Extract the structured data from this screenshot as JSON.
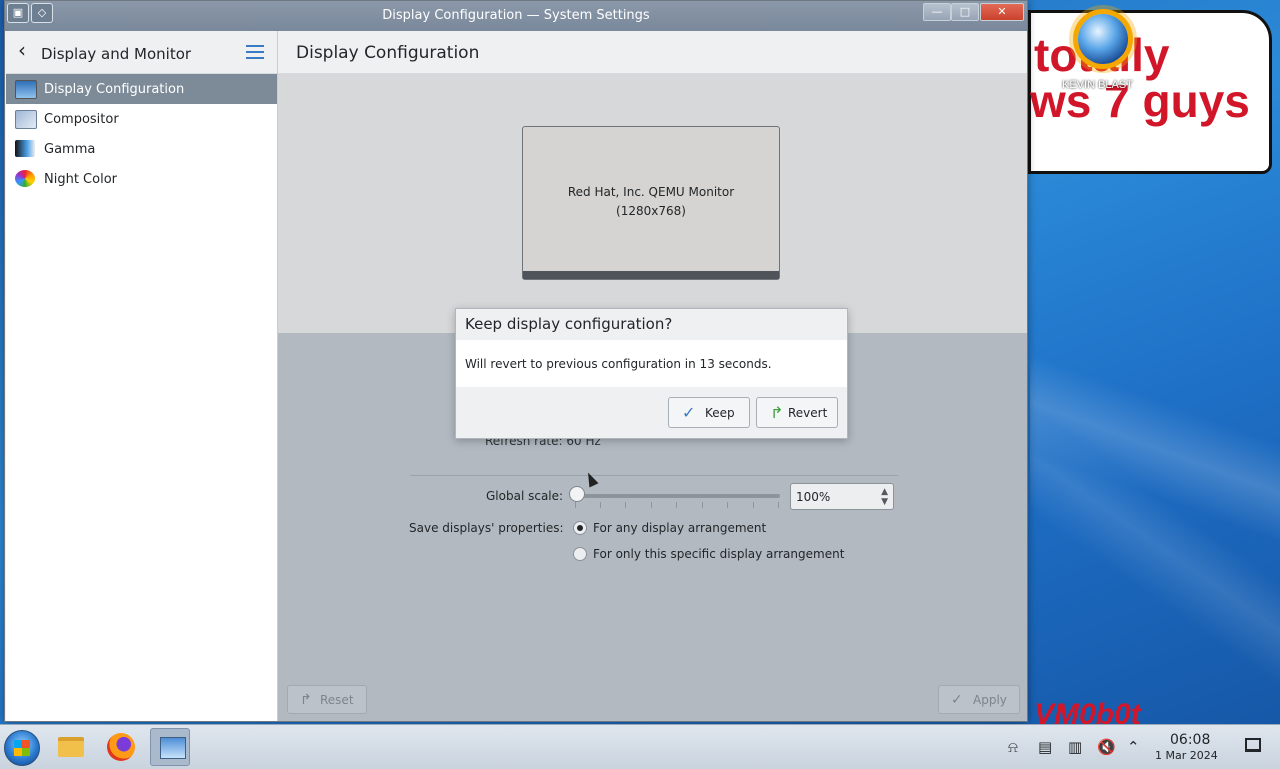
{
  "window": {
    "title": "Display Configuration — System Settings",
    "minimize_glyph": "—",
    "maximize_glyph": "□",
    "close_glyph": "✕"
  },
  "sidebar": {
    "header_title": "Display and Monitor",
    "items": [
      {
        "label": "Display Configuration",
        "icon": "display-icon",
        "selected": true
      },
      {
        "label": "Compositor",
        "icon": "compositor-icon",
        "selected": false
      },
      {
        "label": "Gamma",
        "icon": "gamma-icon",
        "selected": false
      },
      {
        "label": "Night Color",
        "icon": "night-color-icon",
        "selected": false
      }
    ]
  },
  "main": {
    "title": "Display Configuration",
    "monitor": {
      "name": "Red Hat, Inc. QEMU Monitor",
      "resolution": "(1280x768)"
    },
    "refresh_rate_label": "Refresh rate: 60 Hz",
    "global_scale": {
      "label": "Global scale:",
      "value": "100%",
      "slider_fraction": 0.0
    },
    "save_properties": {
      "label": "Save displays' properties:",
      "options": [
        {
          "label": "For any display arrangement",
          "checked": true
        },
        {
          "label": "For only this specific display arrangement",
          "checked": false
        }
      ]
    },
    "footer": {
      "reset_label": "Reset",
      "apply_label": "Apply"
    }
  },
  "dialog": {
    "title": "Keep display configuration?",
    "message": "Will revert to previous configuration in 13 seconds.",
    "keep_label": "Keep",
    "revert_label": "Revert"
  },
  "desktop": {
    "meme_line1": "totally",
    "meme_line2": "ws 7 guys",
    "kevin_label": "KEVIN BLAST",
    "watermark": "VM0b0t"
  },
  "taskbar": {
    "apps": [
      "file-manager-icon",
      "firefox-icon",
      "system-settings-icon"
    ],
    "tray": [
      "notifications-icon",
      "clipboard-icon",
      "storage-icon",
      "volume-muted-icon",
      "expand-tray-icon"
    ],
    "time": "06:08",
    "date": "1 Mar 2024"
  },
  "colors": {
    "selection": "#7d8b99",
    "titlebar": "#7a889b",
    "accent": "#3a7bc8",
    "meme_red": "#d2162a"
  }
}
